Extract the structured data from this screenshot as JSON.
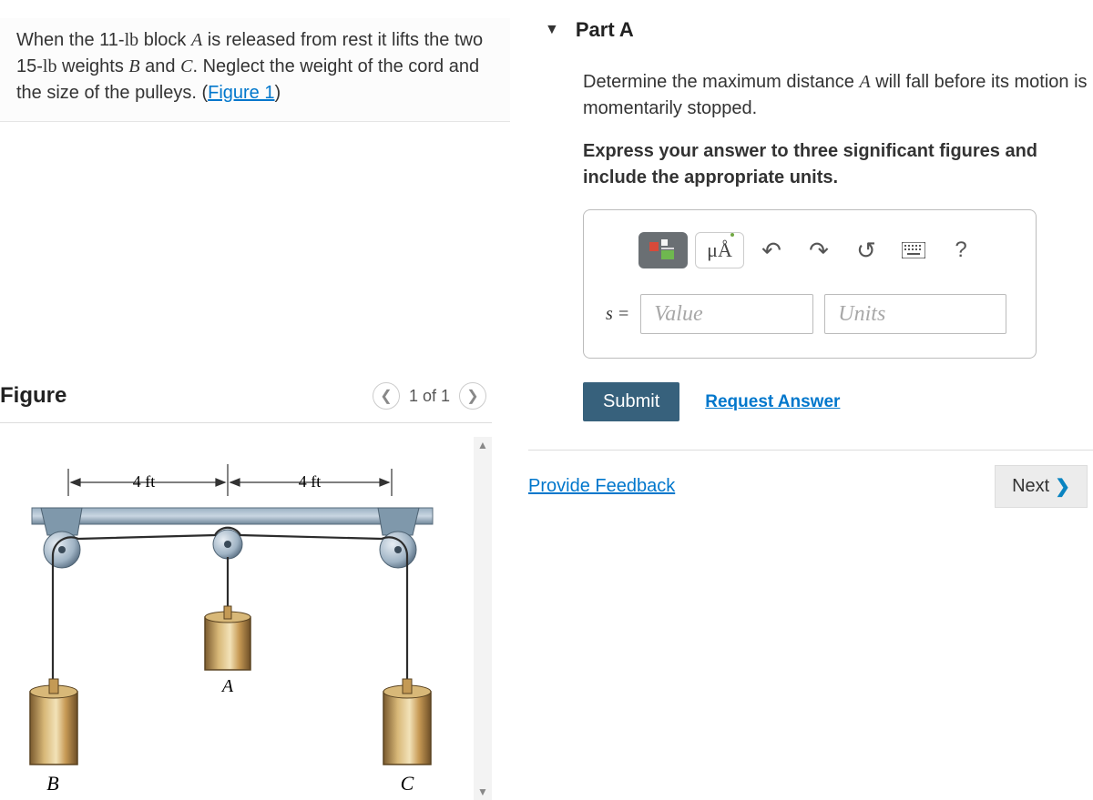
{
  "problem": {
    "text_prefix": "When the 11-",
    "lb1": "lb",
    "text_mid1": " block ",
    "A": "A",
    "text_mid2": " is released from rest it lifts the two 15-",
    "lb2": "lb",
    "text_mid3": " weights ",
    "B": "B",
    "and": " and ",
    "C": "C",
    "text_mid4": ". Neglect the weight of the cord and the size of the pulleys. (",
    "figure_link": "Figure 1",
    "close": ")"
  },
  "figure": {
    "title": "Figure",
    "counter": "1 of 1",
    "dim_left": "4 ft",
    "dim_right": "4 ft",
    "label_A": "A",
    "label_B": "B",
    "label_C": "C"
  },
  "part": {
    "header": "Part A",
    "instruction_prefix": "Determine the maximum distance ",
    "instruction_A": "A",
    "instruction_suffix": " will fall before its motion is momentarily stopped.",
    "precision": "Express your answer to three significant figures and include the appropriate units.",
    "units_btn": "μÅ",
    "help_btn": "?",
    "var_label": "s =",
    "value_placeholder": "Value",
    "units_placeholder": "Units",
    "submit": "Submit",
    "request": "Request Answer"
  },
  "footer": {
    "provide": "Provide Feedback",
    "next": "Next"
  }
}
